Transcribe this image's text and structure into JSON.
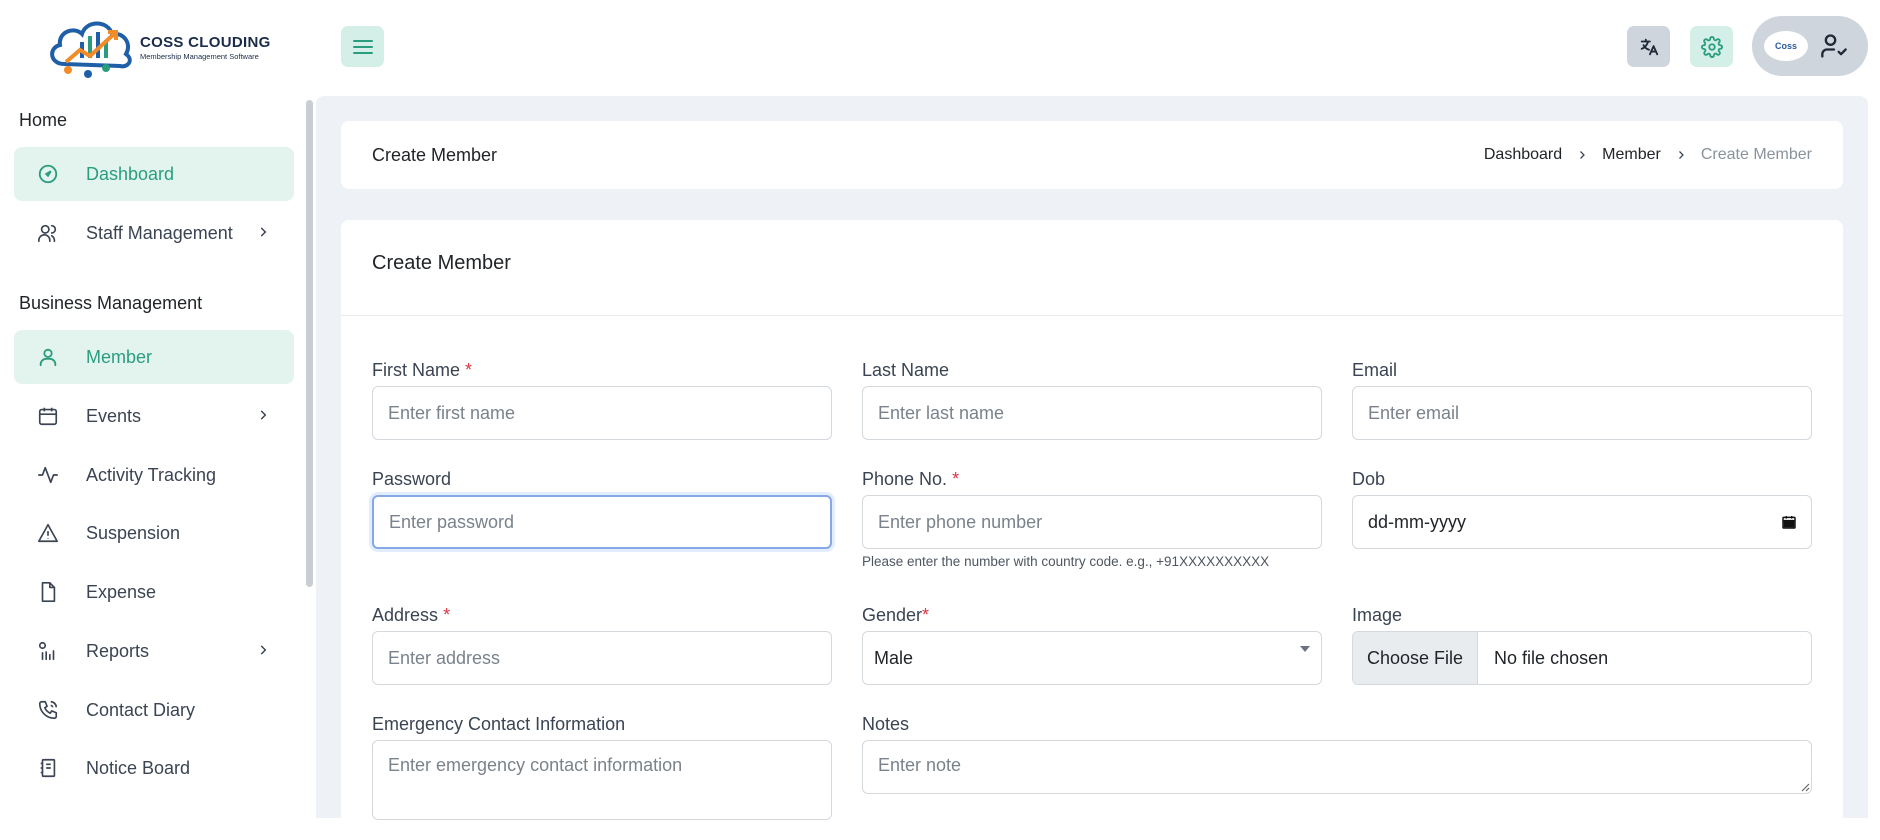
{
  "app": {
    "logo_title": "COSS CLOUDING",
    "logo_subtitle": "Membership Management Software",
    "avatar_text": "Coss"
  },
  "icons": {
    "menu": "hamburger-icon",
    "language": "translate-icon",
    "settings": "gear-icon",
    "user": "user-check-icon"
  },
  "colors": {
    "accent": "#2a9d7f",
    "accent_bg": "#e3f4ee",
    "required": "#dc3545",
    "page_bg": "#eef2f6"
  },
  "sidebar": {
    "section_home": "Home",
    "section_business": "Business Management",
    "items": [
      {
        "label": "Dashboard",
        "icon": "dashboard-icon",
        "active": true,
        "has_submenu": false
      },
      {
        "label": "Staff Management",
        "icon": "users-icon",
        "active": false,
        "has_submenu": true
      },
      {
        "label": "Member",
        "icon": "user-icon",
        "active": true,
        "has_submenu": false
      },
      {
        "label": "Events",
        "icon": "calendar-icon",
        "active": false,
        "has_submenu": true
      },
      {
        "label": "Activity Tracking",
        "icon": "activity-icon",
        "active": false,
        "has_submenu": false
      },
      {
        "label": "Suspension",
        "icon": "warning-icon",
        "active": false,
        "has_submenu": false
      },
      {
        "label": "Expense",
        "icon": "document-icon",
        "active": false,
        "has_submenu": false
      },
      {
        "label": "Reports",
        "icon": "reports-icon",
        "active": false,
        "has_submenu": true
      },
      {
        "label": "Contact Diary",
        "icon": "phone-icon",
        "active": false,
        "has_submenu": false
      },
      {
        "label": "Notice Board",
        "icon": "notice-icon",
        "active": false,
        "has_submenu": false
      }
    ]
  },
  "header": {
    "page_title": "Create Member",
    "breadcrumb": [
      "Dashboard",
      "Member",
      "Create Member"
    ]
  },
  "form": {
    "title": "Create Member",
    "first_name": {
      "label": "First Name",
      "required": "*",
      "placeholder": "Enter first name",
      "value": ""
    },
    "last_name": {
      "label": "Last Name",
      "placeholder": "Enter last name",
      "value": ""
    },
    "email": {
      "label": "Email",
      "placeholder": "Enter email",
      "value": ""
    },
    "password": {
      "label": "Password",
      "placeholder": "Enter password",
      "value": ""
    },
    "phone": {
      "label": "Phone No.",
      "required": "*",
      "placeholder": "Enter phone number",
      "value": "",
      "help": "Please enter the number with country code. e.g., +91XXXXXXXXXX"
    },
    "dob": {
      "label": "Dob",
      "value": "dd-mm-yyyy"
    },
    "address": {
      "label": "Address",
      "required": "*",
      "placeholder": "Enter address",
      "value": ""
    },
    "gender": {
      "label": "Gender",
      "required": "*",
      "value": "Male"
    },
    "image": {
      "label": "Image",
      "button": "Choose File",
      "status": "No file chosen"
    },
    "emergency": {
      "label": "Emergency Contact Information",
      "placeholder": "Enter emergency contact information"
    },
    "notes": {
      "label": "Notes",
      "placeholder": "Enter note"
    }
  }
}
